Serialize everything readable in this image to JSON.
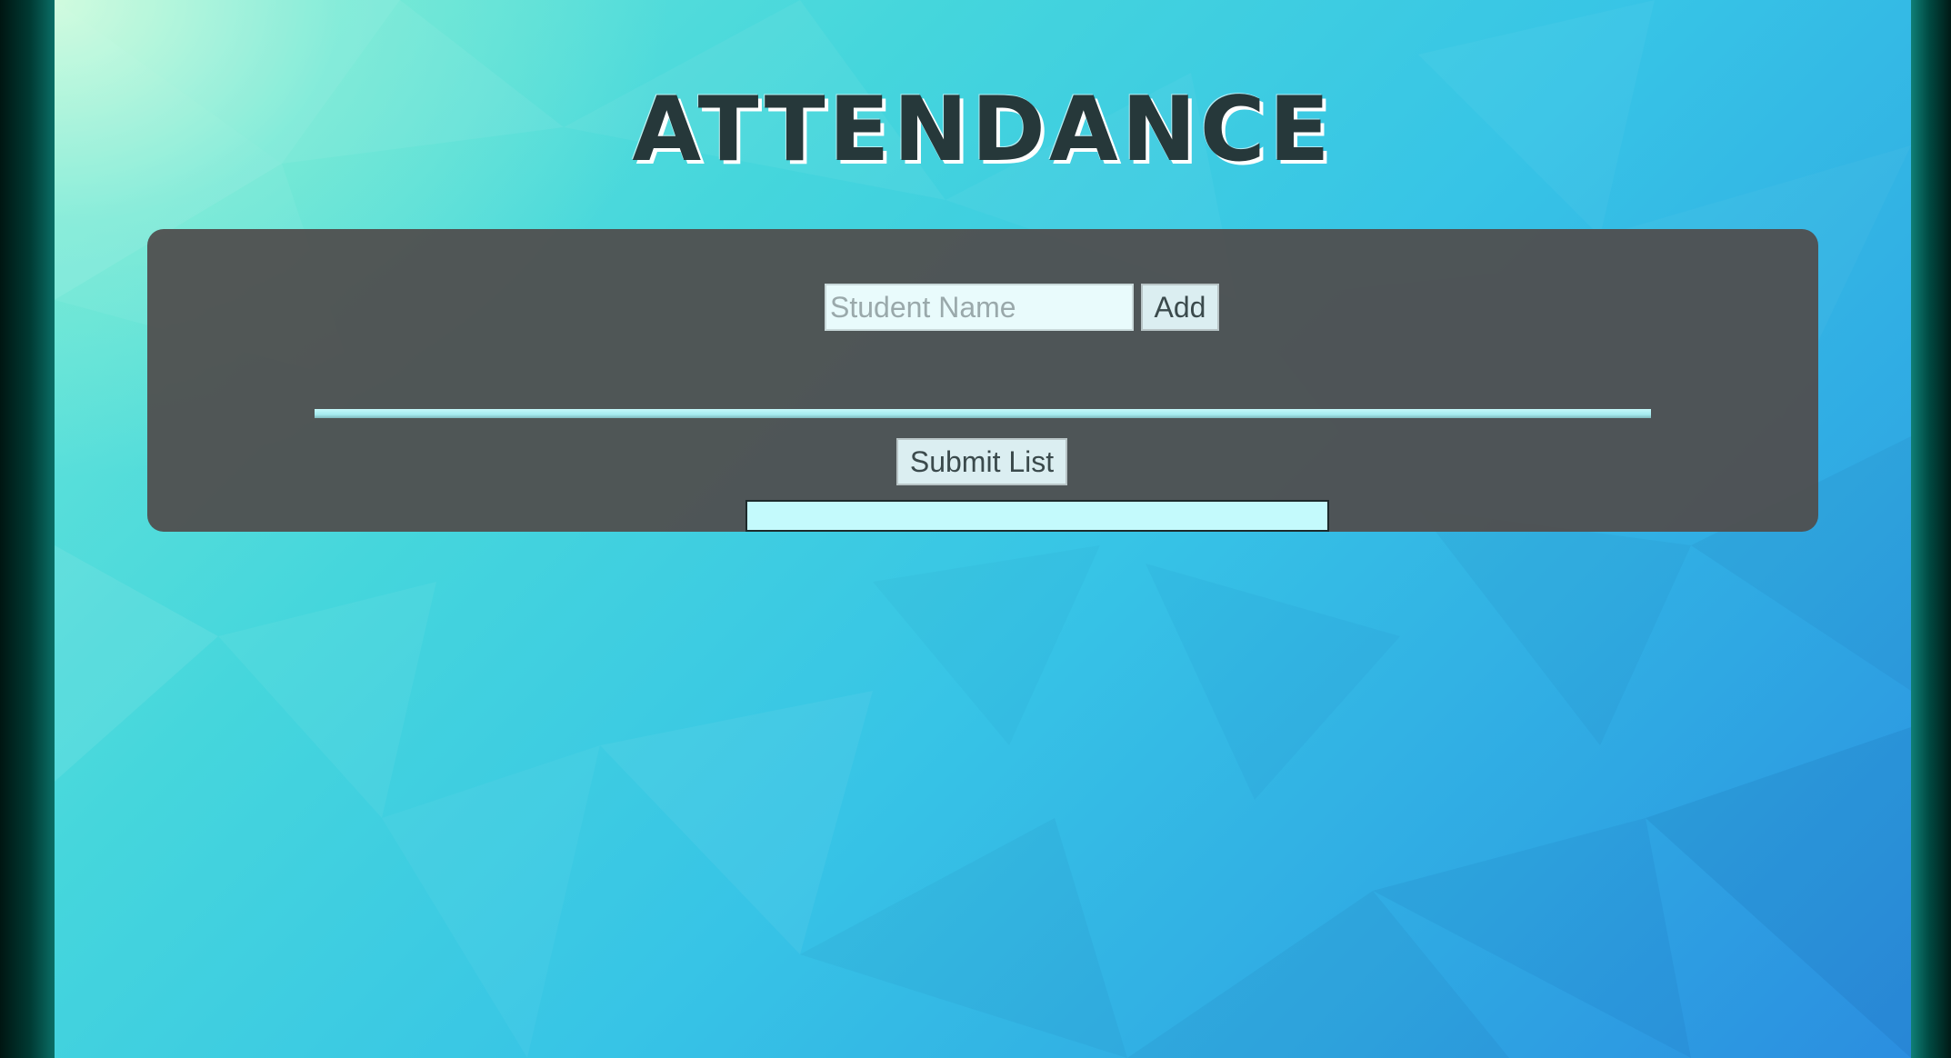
{
  "page": {
    "title": "ATTENDANCE"
  },
  "form": {
    "name_placeholder": "Student Name",
    "name_value": "",
    "add_label": "Add",
    "submit_label": "Submit List"
  },
  "attendance_list": {
    "items": []
  },
  "colors": {
    "panel": "#504e4e",
    "title_text": "#26383a",
    "divider": "#c4f8fa",
    "list_box": "#c4fafc",
    "button_bg": "#dbeef1",
    "input_bg": "#e9fbfc"
  }
}
